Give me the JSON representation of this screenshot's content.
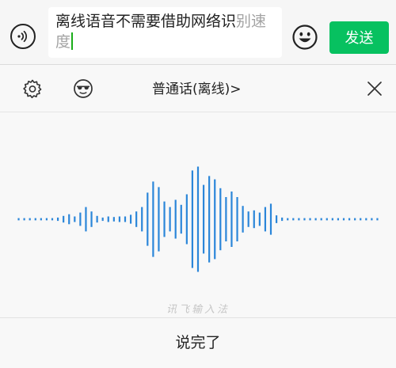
{
  "input": {
    "text_committed": "离线语音不需要借助网络识",
    "text_pending": "别速度"
  },
  "header": {
    "send_label": "发送"
  },
  "voice_panel": {
    "mode_label": "普通话(离线)",
    "mode_chevron": ">",
    "brand_watermark": "讯飞输入法",
    "done_label": "说完了",
    "accent_color": "#1aad19",
    "waveform_color": "#2b86d9",
    "waveform_levels": [
      0.02,
      0.02,
      0.02,
      0.02,
      0.02,
      0.02,
      0.02,
      0.03,
      0.06,
      0.09,
      0.05,
      0.12,
      0.22,
      0.14,
      0.06,
      0.03,
      0.05,
      0.04,
      0.05,
      0.05,
      0.08,
      0.14,
      0.22,
      0.48,
      0.68,
      0.58,
      0.32,
      0.22,
      0.35,
      0.26,
      0.45,
      0.88,
      0.95,
      0.62,
      0.78,
      0.72,
      0.56,
      0.4,
      0.5,
      0.4,
      0.24,
      0.14,
      0.16,
      0.12,
      0.22,
      0.28,
      0.07,
      0.03,
      0.02,
      0.02,
      0.02,
      0.02,
      0.02,
      0.02,
      0.02,
      0.02,
      0.02,
      0.02,
      0.02,
      0.02,
      0.02,
      0.02,
      0.02,
      0.02,
      0.02
    ]
  },
  "icons": {
    "voice_toggle": "voice-wave-icon",
    "emoji": "smiley-icon",
    "settings": "gear-icon",
    "skin": "sunglasses-face-icon",
    "close": "close-icon"
  }
}
